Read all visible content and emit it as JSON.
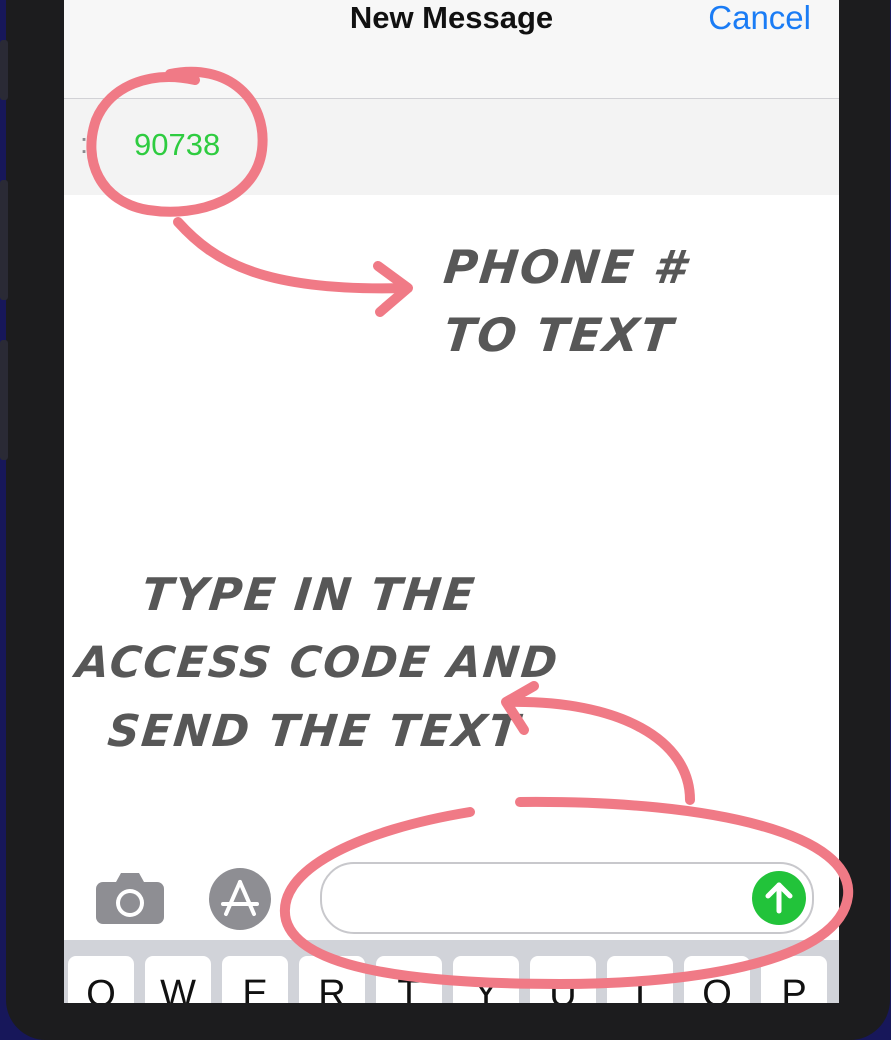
{
  "nav": {
    "title": "New Message",
    "cancel_label": "Cancel"
  },
  "recipient": {
    "label": ":",
    "number": "90738"
  },
  "annotations": {
    "phone_line1": "PHONE #",
    "phone_line2": "TO TEXT",
    "type_line1": "TYPE IN THE",
    "type_line2": "ACCESS CODE AND",
    "type_line3": "SEND THE TEXT"
  },
  "composer": {
    "placeholder": ""
  },
  "keyboard": {
    "keys": [
      "Q",
      "W",
      "E",
      "R",
      "T",
      "Y",
      "U",
      "I",
      "O",
      "P"
    ]
  },
  "colors": {
    "accent": "#1a7cf5",
    "recipient": "#2ecc40",
    "send": "#22c33a",
    "annotation_marker": "#f07a86"
  },
  "icons": {
    "camera": "camera-icon",
    "apps": "app-store-icon",
    "send": "arrow-up-icon",
    "annotation": "hand-drawn-arrow-icon"
  }
}
